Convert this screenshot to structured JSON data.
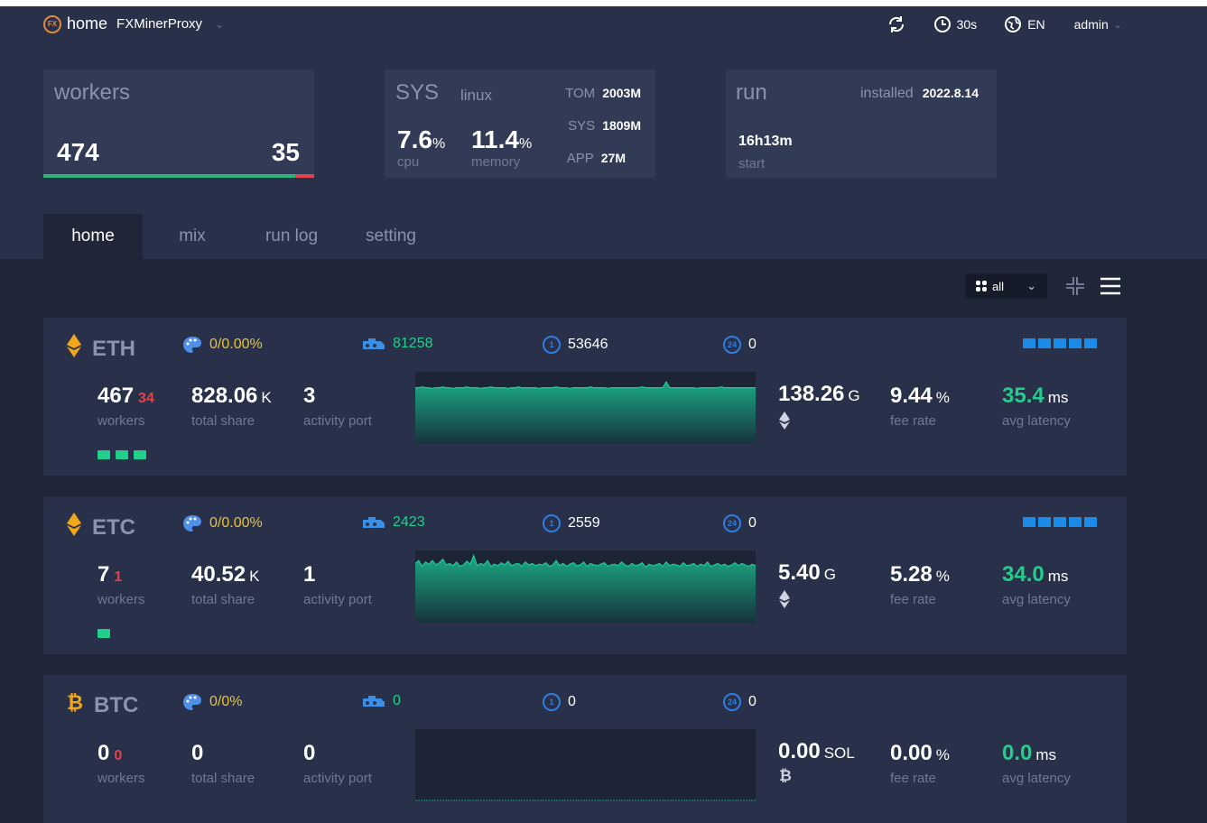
{
  "header": {
    "home_label": "home",
    "app_name": "FXMinerProxy",
    "refresh_interval": "30s",
    "language": "EN",
    "user": "admin"
  },
  "workers_card": {
    "title": "workers",
    "online": "474",
    "offline": "35",
    "online_fraction": 0.931
  },
  "sys_card": {
    "title": "SYS",
    "os": "linux",
    "cpu_value": "7.6",
    "cpu_unit": "%",
    "cpu_label": "cpu",
    "mem_value": "11.4",
    "mem_unit": "%",
    "mem_label": "memory",
    "tom_label": "TOM",
    "tom_value": "2003M",
    "sys_label": "SYS",
    "sys_value": "1809M",
    "app_label": "APP",
    "app_value": "27M"
  },
  "run_card": {
    "title": "run",
    "installed_label": "installed",
    "installed_value": "2022.8.14",
    "uptime": "16h13m",
    "uptime_label": "start"
  },
  "tabs": [
    {
      "label": "home",
      "active": true
    },
    {
      "label": "mix",
      "active": false
    },
    {
      "label": "run log",
      "active": false
    },
    {
      "label": "setting",
      "active": false
    }
  ],
  "toolbar": {
    "filter_value": "all"
  },
  "coins": [
    {
      "symbol": "ETH",
      "icon": "ethereum-icon",
      "fee_ratio": "0/0.00%",
      "rigs": "81258",
      "shares_1h": "53646",
      "shares_24h": "0",
      "workers": "467",
      "workers_offline": "34",
      "workers_label": "workers",
      "total_share": "828.06",
      "total_share_unit": "K",
      "total_share_label": "total share",
      "activity_port": "3",
      "activity_port_label": "activity port",
      "hashrate": "138.26",
      "hashrate_unit": "G",
      "fee_rate": "9.44",
      "fee_rate_unit": "%",
      "fee_rate_label": "fee rate",
      "latency": "35.4",
      "latency_unit": "ms",
      "latency_label": "avg latency",
      "port_dots": 3,
      "series": [
        0.78,
        0.78,
        0.79,
        0.78,
        0.78,
        0.77,
        0.78,
        0.78,
        0.79,
        0.78,
        0.78,
        0.77,
        0.78,
        0.78,
        0.78,
        0.79,
        0.78,
        0.78,
        0.78,
        0.77,
        0.78,
        0.78,
        0.79,
        0.78,
        0.78,
        0.78,
        0.78,
        0.77,
        0.78,
        0.78,
        0.79,
        0.78,
        0.78,
        0.78,
        0.78,
        0.78,
        0.77,
        0.78,
        0.78,
        0.78,
        0.78,
        0.79,
        0.78,
        0.78,
        0.78,
        0.77,
        0.78,
        0.78,
        0.78,
        0.78,
        0.78,
        0.79,
        0.78,
        0.78,
        0.78,
        0.78,
        0.77,
        0.78,
        0.78,
        0.78,
        0.78,
        0.78,
        0.78,
        0.78,
        0.78,
        0.78,
        0.79,
        0.78,
        0.78,
        0.78,
        0.78,
        0.78,
        0.78,
        0.86,
        0.78,
        0.78,
        0.78,
        0.78,
        0.78,
        0.78,
        0.78,
        0.78,
        0.77,
        0.78,
        0.78,
        0.78,
        0.78,
        0.78,
        0.78,
        0.79,
        0.78,
        0.78,
        0.78,
        0.78,
        0.78,
        0.78,
        0.78,
        0.78,
        0.78,
        0.78
      ]
    },
    {
      "symbol": "ETC",
      "icon": "ethereum-classic-icon",
      "fee_ratio": "0/0.00%",
      "rigs": "2423",
      "shares_1h": "2559",
      "shares_24h": "0",
      "workers": "7",
      "workers_offline": "1",
      "workers_label": "workers",
      "total_share": "40.52",
      "total_share_unit": "K",
      "total_share_label": "total share",
      "activity_port": "1",
      "activity_port_label": "activity port",
      "hashrate": "5.40",
      "hashrate_unit": "G",
      "fee_rate": "5.28",
      "fee_rate_unit": "%",
      "fee_rate_label": "fee rate",
      "latency": "34.0",
      "latency_unit": "ms",
      "latency_label": "avg latency",
      "port_dots": 1,
      "series": [
        0.82,
        0.86,
        0.78,
        0.84,
        0.81,
        0.86,
        0.8,
        0.83,
        0.88,
        0.8,
        0.82,
        0.79,
        0.84,
        0.78,
        0.8,
        0.85,
        0.81,
        0.93,
        0.79,
        0.82,
        0.8,
        0.86,
        0.78,
        0.81,
        0.79,
        0.83,
        0.8,
        0.85,
        0.79,
        0.81,
        0.82,
        0.78,
        0.84,
        0.8,
        0.82,
        0.79,
        0.81,
        0.8,
        0.83,
        0.78,
        0.8,
        0.86,
        0.79,
        0.82,
        0.78,
        0.81,
        0.83,
        0.79,
        0.8,
        0.84,
        0.78,
        0.82,
        0.8,
        0.79,
        0.81,
        0.83,
        0.78,
        0.8,
        0.81,
        0.79,
        0.84,
        0.8,
        0.78,
        0.82,
        0.79,
        0.8,
        0.83,
        0.77,
        0.81,
        0.79,
        0.8,
        0.82,
        0.78,
        0.84,
        0.79,
        0.81,
        0.8,
        0.78,
        0.83,
        0.79,
        0.8,
        0.82,
        0.78,
        0.81,
        0.79,
        0.84,
        0.78,
        0.8,
        0.82,
        0.79,
        0.81,
        0.78,
        0.8,
        0.83,
        0.79,
        0.82,
        0.8,
        0.78,
        0.81,
        0.79
      ]
    },
    {
      "symbol": "BTC",
      "icon": "bitcoin-icon",
      "fee_ratio": "0/0%",
      "rigs": "0",
      "shares_1h": "0",
      "shares_24h": "0",
      "workers": "0",
      "workers_offline": "0",
      "workers_label": "workers",
      "total_share": "0",
      "total_share_unit": "",
      "total_share_label": "total share",
      "activity_port": "0",
      "activity_port_label": "activity port",
      "hashrate": "0.00",
      "hashrate_unit": "SOL",
      "fee_rate": "0.00",
      "fee_rate_unit": "%",
      "fee_rate_label": "fee rate",
      "latency": "0.0",
      "latency_unit": "ms",
      "latency_label": "avg latency",
      "port_dots": 0,
      "series": []
    }
  ],
  "colors": {
    "accent_green": "#21cf8a",
    "accent_yellow": "#e8c23c",
    "accent_blue": "#1a8be6",
    "danger_red": "#e0434b"
  }
}
